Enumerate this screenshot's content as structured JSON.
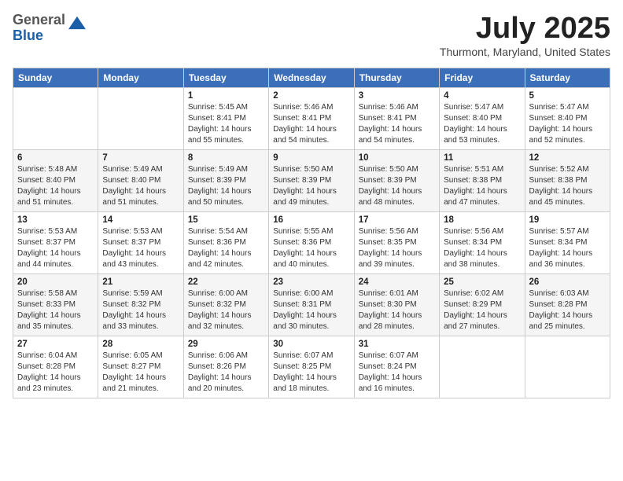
{
  "logo": {
    "general": "General",
    "blue": "Blue"
  },
  "header": {
    "month_year": "July 2025",
    "location": "Thurmont, Maryland, United States"
  },
  "days_of_week": [
    "Sunday",
    "Monday",
    "Tuesday",
    "Wednesday",
    "Thursday",
    "Friday",
    "Saturday"
  ],
  "weeks": [
    [
      {
        "day": "",
        "info": ""
      },
      {
        "day": "",
        "info": ""
      },
      {
        "day": "1",
        "info": "Sunrise: 5:45 AM\nSunset: 8:41 PM\nDaylight: 14 hours and 55 minutes."
      },
      {
        "day": "2",
        "info": "Sunrise: 5:46 AM\nSunset: 8:41 PM\nDaylight: 14 hours and 54 minutes."
      },
      {
        "day": "3",
        "info": "Sunrise: 5:46 AM\nSunset: 8:41 PM\nDaylight: 14 hours and 54 minutes."
      },
      {
        "day": "4",
        "info": "Sunrise: 5:47 AM\nSunset: 8:40 PM\nDaylight: 14 hours and 53 minutes."
      },
      {
        "day": "5",
        "info": "Sunrise: 5:47 AM\nSunset: 8:40 PM\nDaylight: 14 hours and 52 minutes."
      }
    ],
    [
      {
        "day": "6",
        "info": "Sunrise: 5:48 AM\nSunset: 8:40 PM\nDaylight: 14 hours and 51 minutes."
      },
      {
        "day": "7",
        "info": "Sunrise: 5:49 AM\nSunset: 8:40 PM\nDaylight: 14 hours and 51 minutes."
      },
      {
        "day": "8",
        "info": "Sunrise: 5:49 AM\nSunset: 8:39 PM\nDaylight: 14 hours and 50 minutes."
      },
      {
        "day": "9",
        "info": "Sunrise: 5:50 AM\nSunset: 8:39 PM\nDaylight: 14 hours and 49 minutes."
      },
      {
        "day": "10",
        "info": "Sunrise: 5:50 AM\nSunset: 8:39 PM\nDaylight: 14 hours and 48 minutes."
      },
      {
        "day": "11",
        "info": "Sunrise: 5:51 AM\nSunset: 8:38 PM\nDaylight: 14 hours and 47 minutes."
      },
      {
        "day": "12",
        "info": "Sunrise: 5:52 AM\nSunset: 8:38 PM\nDaylight: 14 hours and 45 minutes."
      }
    ],
    [
      {
        "day": "13",
        "info": "Sunrise: 5:53 AM\nSunset: 8:37 PM\nDaylight: 14 hours and 44 minutes."
      },
      {
        "day": "14",
        "info": "Sunrise: 5:53 AM\nSunset: 8:37 PM\nDaylight: 14 hours and 43 minutes."
      },
      {
        "day": "15",
        "info": "Sunrise: 5:54 AM\nSunset: 8:36 PM\nDaylight: 14 hours and 42 minutes."
      },
      {
        "day": "16",
        "info": "Sunrise: 5:55 AM\nSunset: 8:36 PM\nDaylight: 14 hours and 40 minutes."
      },
      {
        "day": "17",
        "info": "Sunrise: 5:56 AM\nSunset: 8:35 PM\nDaylight: 14 hours and 39 minutes."
      },
      {
        "day": "18",
        "info": "Sunrise: 5:56 AM\nSunset: 8:34 PM\nDaylight: 14 hours and 38 minutes."
      },
      {
        "day": "19",
        "info": "Sunrise: 5:57 AM\nSunset: 8:34 PM\nDaylight: 14 hours and 36 minutes."
      }
    ],
    [
      {
        "day": "20",
        "info": "Sunrise: 5:58 AM\nSunset: 8:33 PM\nDaylight: 14 hours and 35 minutes."
      },
      {
        "day": "21",
        "info": "Sunrise: 5:59 AM\nSunset: 8:32 PM\nDaylight: 14 hours and 33 minutes."
      },
      {
        "day": "22",
        "info": "Sunrise: 6:00 AM\nSunset: 8:32 PM\nDaylight: 14 hours and 32 minutes."
      },
      {
        "day": "23",
        "info": "Sunrise: 6:00 AM\nSunset: 8:31 PM\nDaylight: 14 hours and 30 minutes."
      },
      {
        "day": "24",
        "info": "Sunrise: 6:01 AM\nSunset: 8:30 PM\nDaylight: 14 hours and 28 minutes."
      },
      {
        "day": "25",
        "info": "Sunrise: 6:02 AM\nSunset: 8:29 PM\nDaylight: 14 hours and 27 minutes."
      },
      {
        "day": "26",
        "info": "Sunrise: 6:03 AM\nSunset: 8:28 PM\nDaylight: 14 hours and 25 minutes."
      }
    ],
    [
      {
        "day": "27",
        "info": "Sunrise: 6:04 AM\nSunset: 8:28 PM\nDaylight: 14 hours and 23 minutes."
      },
      {
        "day": "28",
        "info": "Sunrise: 6:05 AM\nSunset: 8:27 PM\nDaylight: 14 hours and 21 minutes."
      },
      {
        "day": "29",
        "info": "Sunrise: 6:06 AM\nSunset: 8:26 PM\nDaylight: 14 hours and 20 minutes."
      },
      {
        "day": "30",
        "info": "Sunrise: 6:07 AM\nSunset: 8:25 PM\nDaylight: 14 hours and 18 minutes."
      },
      {
        "day": "31",
        "info": "Sunrise: 6:07 AM\nSunset: 8:24 PM\nDaylight: 14 hours and 16 minutes."
      },
      {
        "day": "",
        "info": ""
      },
      {
        "day": "",
        "info": ""
      }
    ]
  ]
}
